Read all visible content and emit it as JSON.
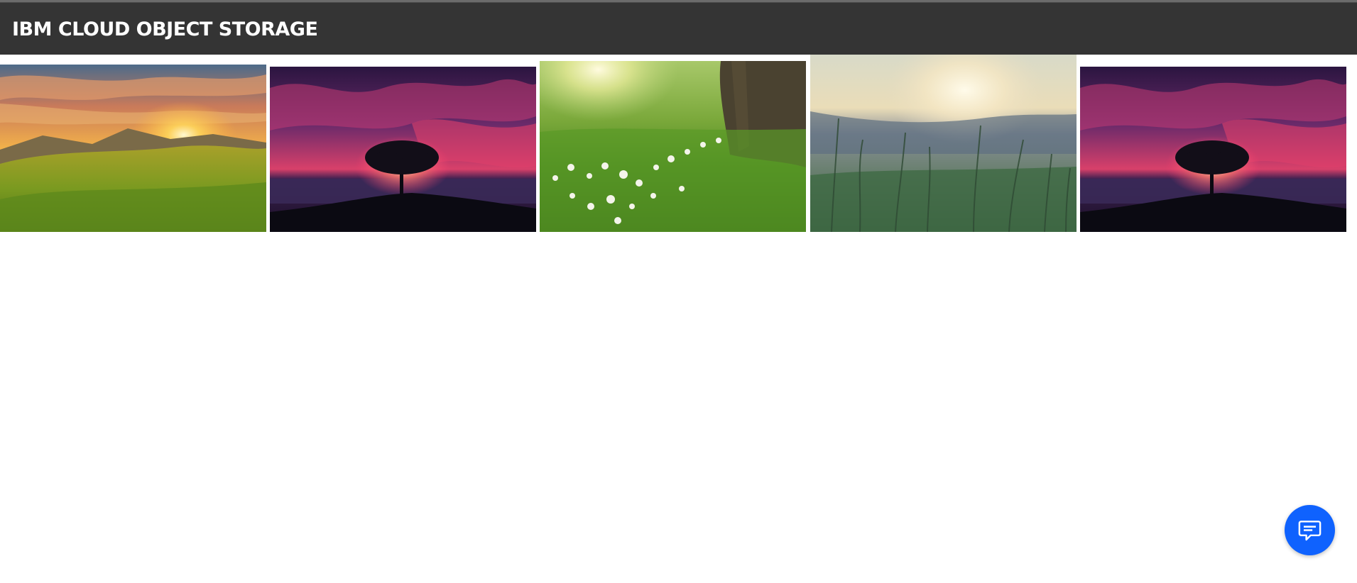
{
  "header": {
    "title": "IBM CLOUD OBJECT STORAGE"
  },
  "gallery": {
    "images": [
      {
        "subject": "sunset over grassy mountains"
      },
      {
        "subject": "tree silhouette under pink sky by the sea"
      },
      {
        "subject": "green meadow with white flowers and tree trunk"
      },
      {
        "subject": "tall grass at misty sunrise"
      },
      {
        "subject": "tree silhouette under pink sky by the sea"
      }
    ]
  },
  "chat": {
    "icon": "chat-icon",
    "color": "#0f62fe"
  },
  "colors": {
    "header_bg": "#343434",
    "header_text": "#ffffff",
    "accent": "#0f62fe"
  }
}
